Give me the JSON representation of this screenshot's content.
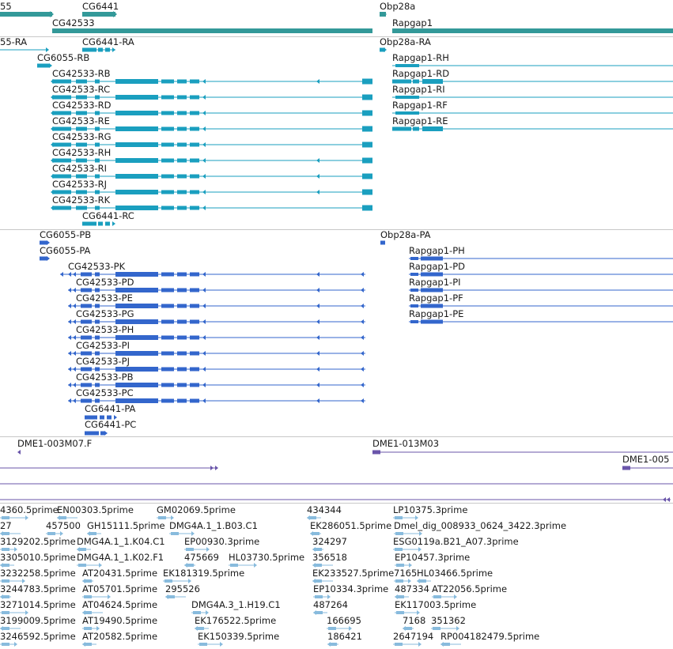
{
  "colors": {
    "genes": "#339999",
    "transcripts": "#1a9fbf",
    "proteins": "#3366cc",
    "clones": "#6a55aa",
    "ests": "#88bbdd",
    "divider": "#c8c8c8"
  },
  "genes": [
    "55",
    "CG6441",
    "Obp28a",
    "CG42533",
    "Rapgap1"
  ],
  "transcripts": [
    "55-RA",
    "CG6441-RA",
    "Obp28a-RA",
    "CG6055-RB",
    "Rapgap1-RH",
    "CG42533-RB",
    "Rapgap1-RD",
    "CG42533-RC",
    "Rapgap1-RI",
    "CG42533-RD",
    "Rapgap1-RF",
    "CG42533-RE",
    "Rapgap1-RE",
    "CG42533-RG",
    "CG42533-RH",
    "CG42533-RI",
    "CG42533-RJ",
    "CG42533-RK",
    "CG6441-RC"
  ],
  "proteins": [
    "CG6055-PB",
    "Obp28a-PA",
    "CG6055-PA",
    "Rapgap1-PH",
    "CG42533-PK",
    "Rapgap1-PD",
    "CG42533-PD",
    "Rapgap1-PI",
    "CG42533-PE",
    "Rapgap1-PF",
    "CG42533-PG",
    "Rapgap1-PE",
    "CG42533-PH",
    "CG42533-PI",
    "CG42533-PJ",
    "CG42533-PB",
    "CG42533-PC",
    "CG6441-PA",
    "CG6441-PC"
  ],
  "clones": [
    "DME1-003M07.F",
    "DME1-013M03",
    "DME1-005"
  ],
  "ests": [
    "4360.5prime",
    "EN00303.5prime",
    "GM02069.5prime",
    "434344",
    "LP10375.3prime",
    "27",
    "457500",
    "GH15111.5prime",
    "DMG4A.1_1.B03.C1",
    "EK286051.5prime",
    "Dmel_dig_008933_0624_3422.3prime",
    "3129202.5prime",
    "DMG4A.1_1.K04.C1",
    "EP00930.3prime",
    "324297",
    "ESG0119a.B21_A07.3prime",
    "3305010.5prime",
    "DMG4A.1_1.K02.F1",
    "475669",
    "HL03730.5prime",
    "356518",
    "EP10457.3prime",
    "3232258.5prime",
    "AT20431.5prime",
    "EK181319.5prime",
    "EK233527.5prime",
    "7165",
    "HL03466.5prime",
    "3244783.5prime",
    "AT05701.5prime",
    "295526",
    "EP10334.3prime",
    "487334",
    "AT22056.5prime",
    "3271014.5prime",
    "AT04624.5prime",
    "DMG4A.3_1.H19.C1",
    "487264",
    "EK117003.5prime",
    "3199009.5prime",
    "AT19490.5prime",
    "EK176522.5prime",
    "166695",
    "7168",
    "351362",
    "3246592.5prime",
    "AT20582.5prime",
    "EK150339.5prime",
    "186421",
    "2647194",
    "RP004182479.5prime"
  ]
}
